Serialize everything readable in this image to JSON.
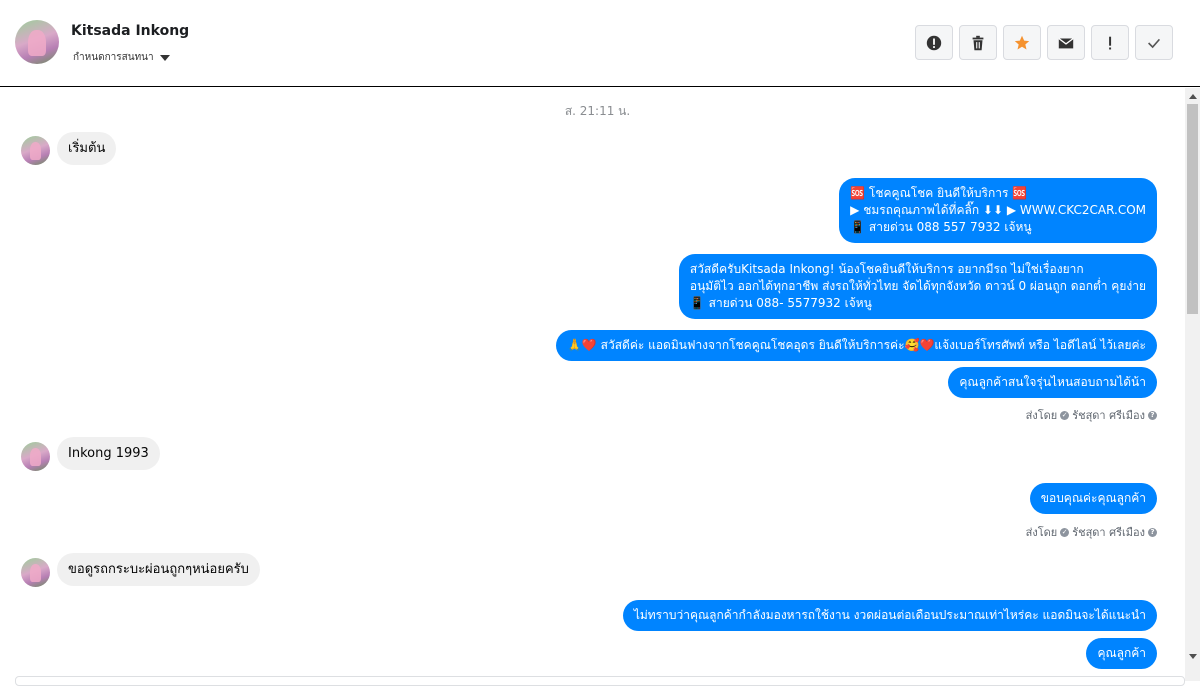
{
  "header": {
    "contact_name": "Kitsada Inkong",
    "contact_sub": "กำหนดการสนทนา",
    "toolbar": [
      {
        "name": "alert-icon",
        "label": "❗"
      },
      {
        "name": "trash-icon",
        "label": "🗑"
      },
      {
        "name": "star-icon",
        "label": "★"
      },
      {
        "name": "mail-icon",
        "label": "✉"
      },
      {
        "name": "exclamation-icon",
        "label": "!"
      },
      {
        "name": "check-icon",
        "label": "✓"
      }
    ],
    "colors": {
      "star": "#f5922f",
      "accent": "#0084ff"
    }
  },
  "chat": {
    "timestamp": "ส. 21:11 น.",
    "messages": [
      {
        "dir": "in",
        "text": "เริ่มต้น"
      },
      {
        "dir": "out",
        "lines": [
          "🆘 โชคคูณโชค ยินดีให้บริการ 🆘",
          "▶ ชมรถคุณภาพได้ที่คลิ๊ก ⬇⬇       ▶ WWW.CKC2CAR.COM",
          "📱 สายด่วน 088 557 7932 เจ้หนู"
        ]
      },
      {
        "dir": "out",
        "lines": [
          "สวัสดีครับKitsada Inkong! น้องโชคยินดีให้บริการ อยากมีรถ ไม่ใช่เรื่องยาก",
          "อนุมัติไว ออกได้ทุกอาชีพ ส่งรถให้ทั่วไทย จัดได้ทุกจังหวัด ดาวน์ 0  ผ่อนถูก ดอกต่ำ คุยง่าย",
          "📱 สายด่วน 088- 5577932 เจ้หนู"
        ]
      },
      {
        "dir": "out",
        "text": "🙏❤️ สวัสดีค่ะ แอดมินฟางจากโชคคูณโชคอุดร ยินดีให้บริการค่ะ🥰❤️แจ้งเบอร์โทรศัพท์ หรือ ไอดีไลน์  ไว้เลยค่ะ"
      },
      {
        "dir": "out",
        "text": "คุณลูกค้าสนใจรุ่นไหนสอบถามได้น้า"
      },
      {
        "dir": "meta",
        "text": "ส่งโดย",
        "sender": "รัชสุดา ศรีเมือง"
      },
      {
        "dir": "in",
        "text": "Inkong 1993"
      },
      {
        "dir": "out",
        "text": "ขอบคุณค่ะคุณลูกค้า"
      },
      {
        "dir": "meta",
        "text": "ส่งโดย",
        "sender": "รัชสุดา ศรีเมือง"
      },
      {
        "dir": "in",
        "text": "ขอดูรถกระบะผ่อนถูกๆหน่อยครับ"
      },
      {
        "dir": "out",
        "text": "ไม่ทราบว่าคุณลูกค้ากำลังมองหารถใช้งาน งวดผ่อนต่อเดือนประมาณเท่าไหร่คะ แอดมินจะได้แนะนำ"
      },
      {
        "dir": "out",
        "text": "คุณลูกค้า"
      }
    ]
  }
}
